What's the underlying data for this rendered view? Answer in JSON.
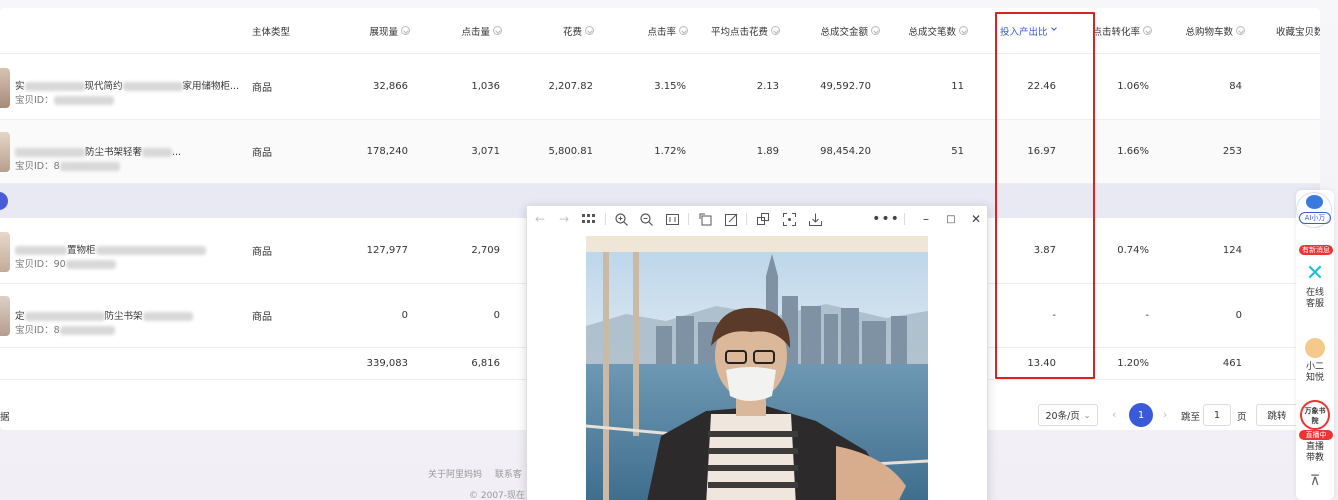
{
  "table": {
    "headers": {
      "type": "主体类型",
      "impressions": "展现量",
      "clicks": "点击量",
      "cost": "花费",
      "ctr": "点击率",
      "cpc": "平均点击花费",
      "gmv": "总成交金额",
      "orders": "总成交笔数",
      "roi": "投入产出比",
      "cvr": "点击转化率",
      "cart": "总购物车数",
      "fav": "收藏宝贝数"
    },
    "rows": [
      {
        "name_a": "实",
        "name_b": "现代简约",
        "name_c": "家用储物柜...",
        "id_label": "宝贝ID：",
        "type": "商品",
        "impressions": "32,866",
        "clicks": "1,036",
        "cost": "2,207.82",
        "ctr": "3.15%",
        "cpc": "2.13",
        "gmv": "49,592.70",
        "orders": "11",
        "roi": "22.46",
        "cvr": "1.06%",
        "cart": "84"
      },
      {
        "name_a": "",
        "name_b": "防尘书架轻奢",
        "name_c": "...",
        "id_label": "宝贝ID：",
        "id_part": "8",
        "type": "商品",
        "impressions": "178,240",
        "clicks": "3,071",
        "cost": "5,800.81",
        "ctr": "1.72%",
        "cpc": "1.89",
        "gmv": "98,454.20",
        "orders": "51",
        "roi": "16.97",
        "cvr": "1.66%",
        "cart": "253"
      },
      {
        "name_a": "",
        "name_b": "置物柜",
        "name_c": "...",
        "id_label": "宝贝ID：",
        "id_part": "90",
        "type": "商品",
        "impressions": "127,977",
        "clicks": "2,709",
        "roi": "3.87",
        "cvr": "0.74%",
        "cart": "124"
      },
      {
        "name_a": "定",
        "name_b": "防尘书架",
        "name_c": "",
        "id_label": "宝贝ID：",
        "id_part": "8",
        "type": "商品",
        "impressions": "0",
        "clicks": "0",
        "roi": "-",
        "cvr": "-",
        "cart": "0"
      }
    ],
    "total": {
      "impressions": "339,083",
      "clicks": "6,816",
      "roi": "13.40",
      "cvr": "1.20%",
      "cart": "461"
    }
  },
  "pager": {
    "left_text": "据",
    "page_size": "20条/页",
    "current_page": "1",
    "goto_label": "跳至",
    "goto_value": "1",
    "page_unit": "页",
    "jump_button": "跳转"
  },
  "footer": {
    "link1": "关于阿里妈妈",
    "link2": "联系客",
    "copyright": "© 2007-现在"
  },
  "right_bar": {
    "ai_label": "AI小万",
    "badge_new_msg": "有新消息",
    "service_label": "在线客服",
    "xiaoer_label": "小二知悦",
    "wanxiang_label": "万象书院",
    "live_badge": "直播中",
    "live_label": "直播带教",
    "top_icon": "back-to-top-icon"
  },
  "viewer": {
    "icons": [
      "back-arrow-icon",
      "forward-arrow-icon",
      "grid-icon",
      "zoom-in-icon",
      "zoom-out-icon",
      "fit-icon",
      "rotate-icon",
      "edit-icon",
      "copy-icon",
      "scan-icon",
      "download-icon",
      "more-icon",
      "minimize-icon",
      "maximize-icon",
      "close-icon"
    ],
    "photo_icon": "portrait-photo"
  },
  "colors": {
    "accent": "#3a5bd9",
    "highlight_box": "#e02020"
  }
}
